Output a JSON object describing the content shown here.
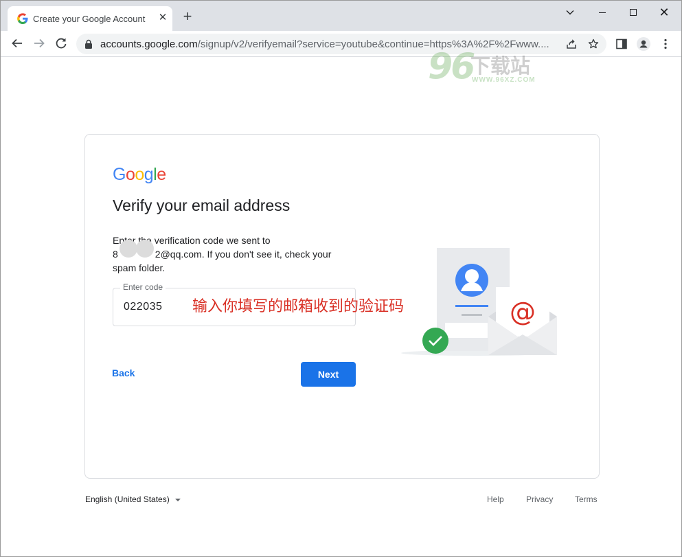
{
  "browser": {
    "tab_title": "Create your Google Account",
    "url_host": "accounts.google.com",
    "url_path": "/signup/v2/verifyemail?service=youtube&continue=https%3A%2F%2Fwww...."
  },
  "watermark": {
    "number": "96",
    "text": "下载站",
    "url": "WWW.96XZ.COM"
  },
  "card": {
    "logo_letters": [
      "G",
      "o",
      "o",
      "g",
      "l",
      "e"
    ],
    "logo_colors": [
      "#4285f4",
      "#ea4335",
      "#fbbc05",
      "#4285f4",
      "#34a853",
      "#ea4335"
    ],
    "heading": "Verify your email address",
    "desc_line1": "Enter the verification code we sent to",
    "desc_email_prefix": "8",
    "desc_email_suffix": "2@qq.com. If you don't see it, check your",
    "desc_line3": "spam folder.",
    "field_label": "Enter code",
    "field_value": "022035",
    "annotation": "输入你填写的邮箱收到的验证码",
    "back_label": "Back",
    "next_label": "Next"
  },
  "footer": {
    "language": "English (United States)",
    "help": "Help",
    "privacy": "Privacy",
    "terms": "Terms"
  },
  "colors": {
    "accent": "#1a73e8",
    "annotation_red": "#d93025",
    "success_green": "#34a853"
  }
}
